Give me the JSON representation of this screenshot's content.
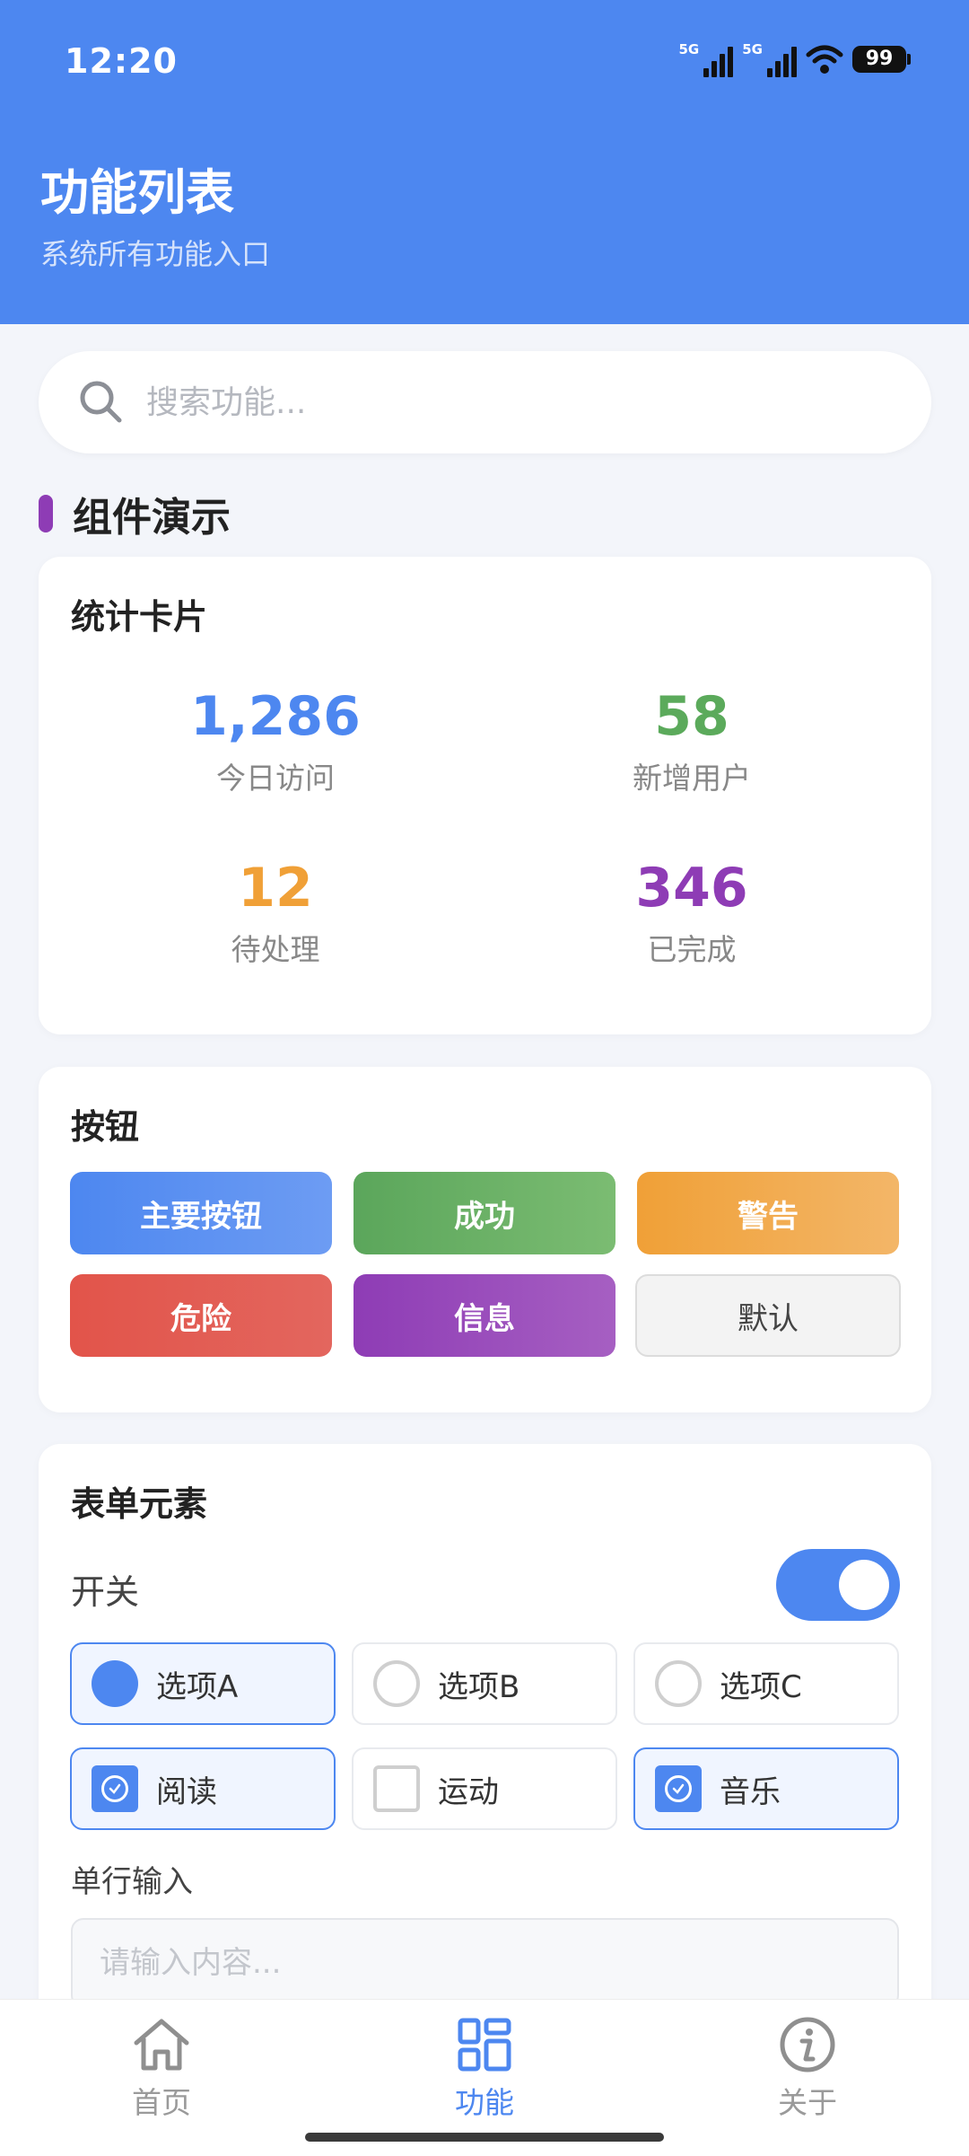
{
  "status_bar": {
    "time": "12:20",
    "net1": "5G",
    "net2": "5G",
    "battery": "99"
  },
  "header": {
    "title": "功能列表",
    "subtitle": "系统所有功能入口"
  },
  "search": {
    "placeholder": "搜索功能..."
  },
  "section": {
    "title": "组件演示"
  },
  "stats_card": {
    "title": "统计卡片",
    "items": [
      {
        "value": "1,286",
        "label": "今日访问",
        "color": "#4D87F0"
      },
      {
        "value": "58",
        "label": "新增用户",
        "color": "#5BAA5B"
      },
      {
        "value": "12",
        "label": "待处理",
        "color": "#F0A037"
      },
      {
        "value": "346",
        "label": "已完成",
        "color": "#8E3CB5"
      }
    ]
  },
  "buttons_card": {
    "title": "按钮",
    "buttons": [
      {
        "label": "主要按钮",
        "color": "#4D87F0"
      },
      {
        "label": "成功",
        "color": "#5BAA5B"
      },
      {
        "label": "警告",
        "color": "#F0A037"
      },
      {
        "label": "危险",
        "color": "#E2544A"
      },
      {
        "label": "信息",
        "color": "#8E3CB5"
      },
      {
        "label": "默认",
        "color": "#F3F3F3"
      }
    ]
  },
  "form_card": {
    "title": "表单元素",
    "switch_label": "开关",
    "switch_on": true,
    "radios": [
      {
        "label": "选项A",
        "checked": true
      },
      {
        "label": "选项B",
        "checked": false
      },
      {
        "label": "选项C",
        "checked": false
      }
    ],
    "checkboxes": [
      {
        "label": "阅读",
        "checked": true
      },
      {
        "label": "运动",
        "checked": false
      },
      {
        "label": "音乐",
        "checked": true
      }
    ],
    "input_label": "单行输入",
    "input_placeholder": "请输入内容..."
  },
  "tabbar": {
    "tabs": [
      {
        "label": "首页",
        "icon": "home-icon",
        "active": false
      },
      {
        "label": "功能",
        "icon": "grid-icon",
        "active": true
      },
      {
        "label": "关于",
        "icon": "info-icon",
        "active": false
      }
    ]
  }
}
